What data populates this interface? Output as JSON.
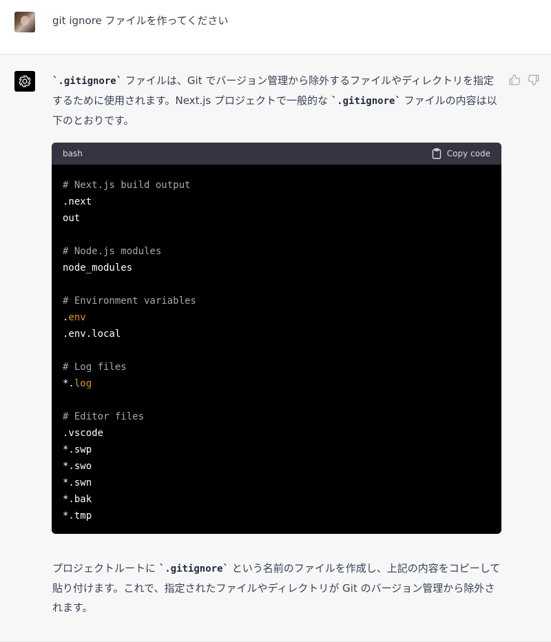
{
  "user": {
    "message": "git ignore ファイルを作ってください"
  },
  "assistant": {
    "intro": {
      "t1": "`.gitignore`",
      "t2": " ファイルは、Git でバージョン管理から除外するファイルやディレクトリを指定するために使用されます。Next.js プロジェクトで一般的な ",
      "t3": "`.gitignore`",
      "t4": " ファイルの内容は以下のとおりです。"
    },
    "code": {
      "language": "bash",
      "copy_label": "Copy code",
      "lines": [
        {
          "a": "# Next.js build output",
          "b": ""
        },
        {
          "a": ".next",
          "b": ""
        },
        {
          "a": "out",
          "b": ""
        },
        {
          "a": "",
          "b": ""
        },
        {
          "a": "# Node.js modules",
          "b": ""
        },
        {
          "a": "node_modules",
          "b": ""
        },
        {
          "a": "",
          "b": ""
        },
        {
          "a": "# Environment variables",
          "b": ""
        },
        {
          "a": ".",
          "b": "env"
        },
        {
          "a": ".env.local",
          "b": ""
        },
        {
          "a": "",
          "b": ""
        },
        {
          "a": "# Log files",
          "b": ""
        },
        {
          "a": "*.",
          "b": "log"
        },
        {
          "a": "",
          "b": ""
        },
        {
          "a": "# Editor files",
          "b": ""
        },
        {
          "a": ".vscode",
          "b": ""
        },
        {
          "a": "*.swp",
          "b": ""
        },
        {
          "a": "*.swo",
          "b": ""
        },
        {
          "a": "*.swn",
          "b": ""
        },
        {
          "a": "*.bak",
          "b": ""
        },
        {
          "a": "*.tmp",
          "b": ""
        }
      ]
    },
    "outro": {
      "t1": "プロジェクトルートに ",
      "t2": "`.gitignore`",
      "t3": " という名前のファイルを作成し、上記の内容をコピーして貼り付けます。これで、指定されたファイルやディレクトリが Git のバージョン管理から除外されます。"
    }
  },
  "icons": {
    "avatar": "user-avatar",
    "logo": "openai-logo-icon",
    "feedback_up": "thumbs-up-icon",
    "feedback_down": "thumbs-down-icon",
    "copy": "clipboard-icon"
  },
  "colors": {
    "comment": "#a8a8a8",
    "highlight": "#e9950c",
    "code_header": "#343541",
    "code_bg": "#000000",
    "assistant_bg": "#f7f7f8"
  }
}
